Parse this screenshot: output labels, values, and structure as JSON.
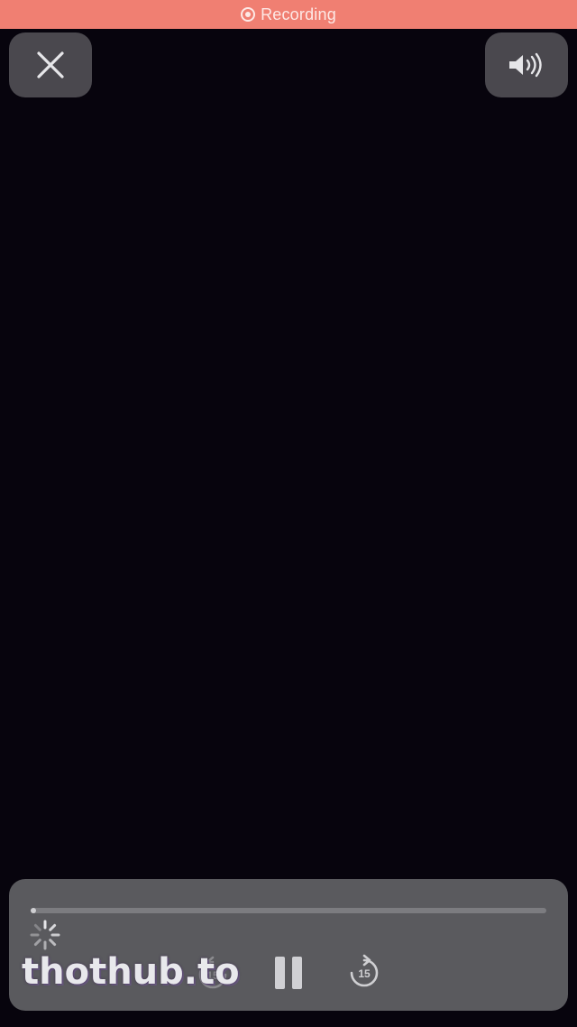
{
  "status_bar": {
    "recording_label": "Recording",
    "color": "#f07f72"
  },
  "top_controls": {
    "close_icon": "close-icon",
    "volume_icon": "speaker-volume-icon"
  },
  "player": {
    "progress": 0.01,
    "loading": true,
    "skip_back_label": "15",
    "skip_forward_label": "15",
    "state": "playing"
  },
  "watermark": {
    "text": "thothub.to"
  }
}
